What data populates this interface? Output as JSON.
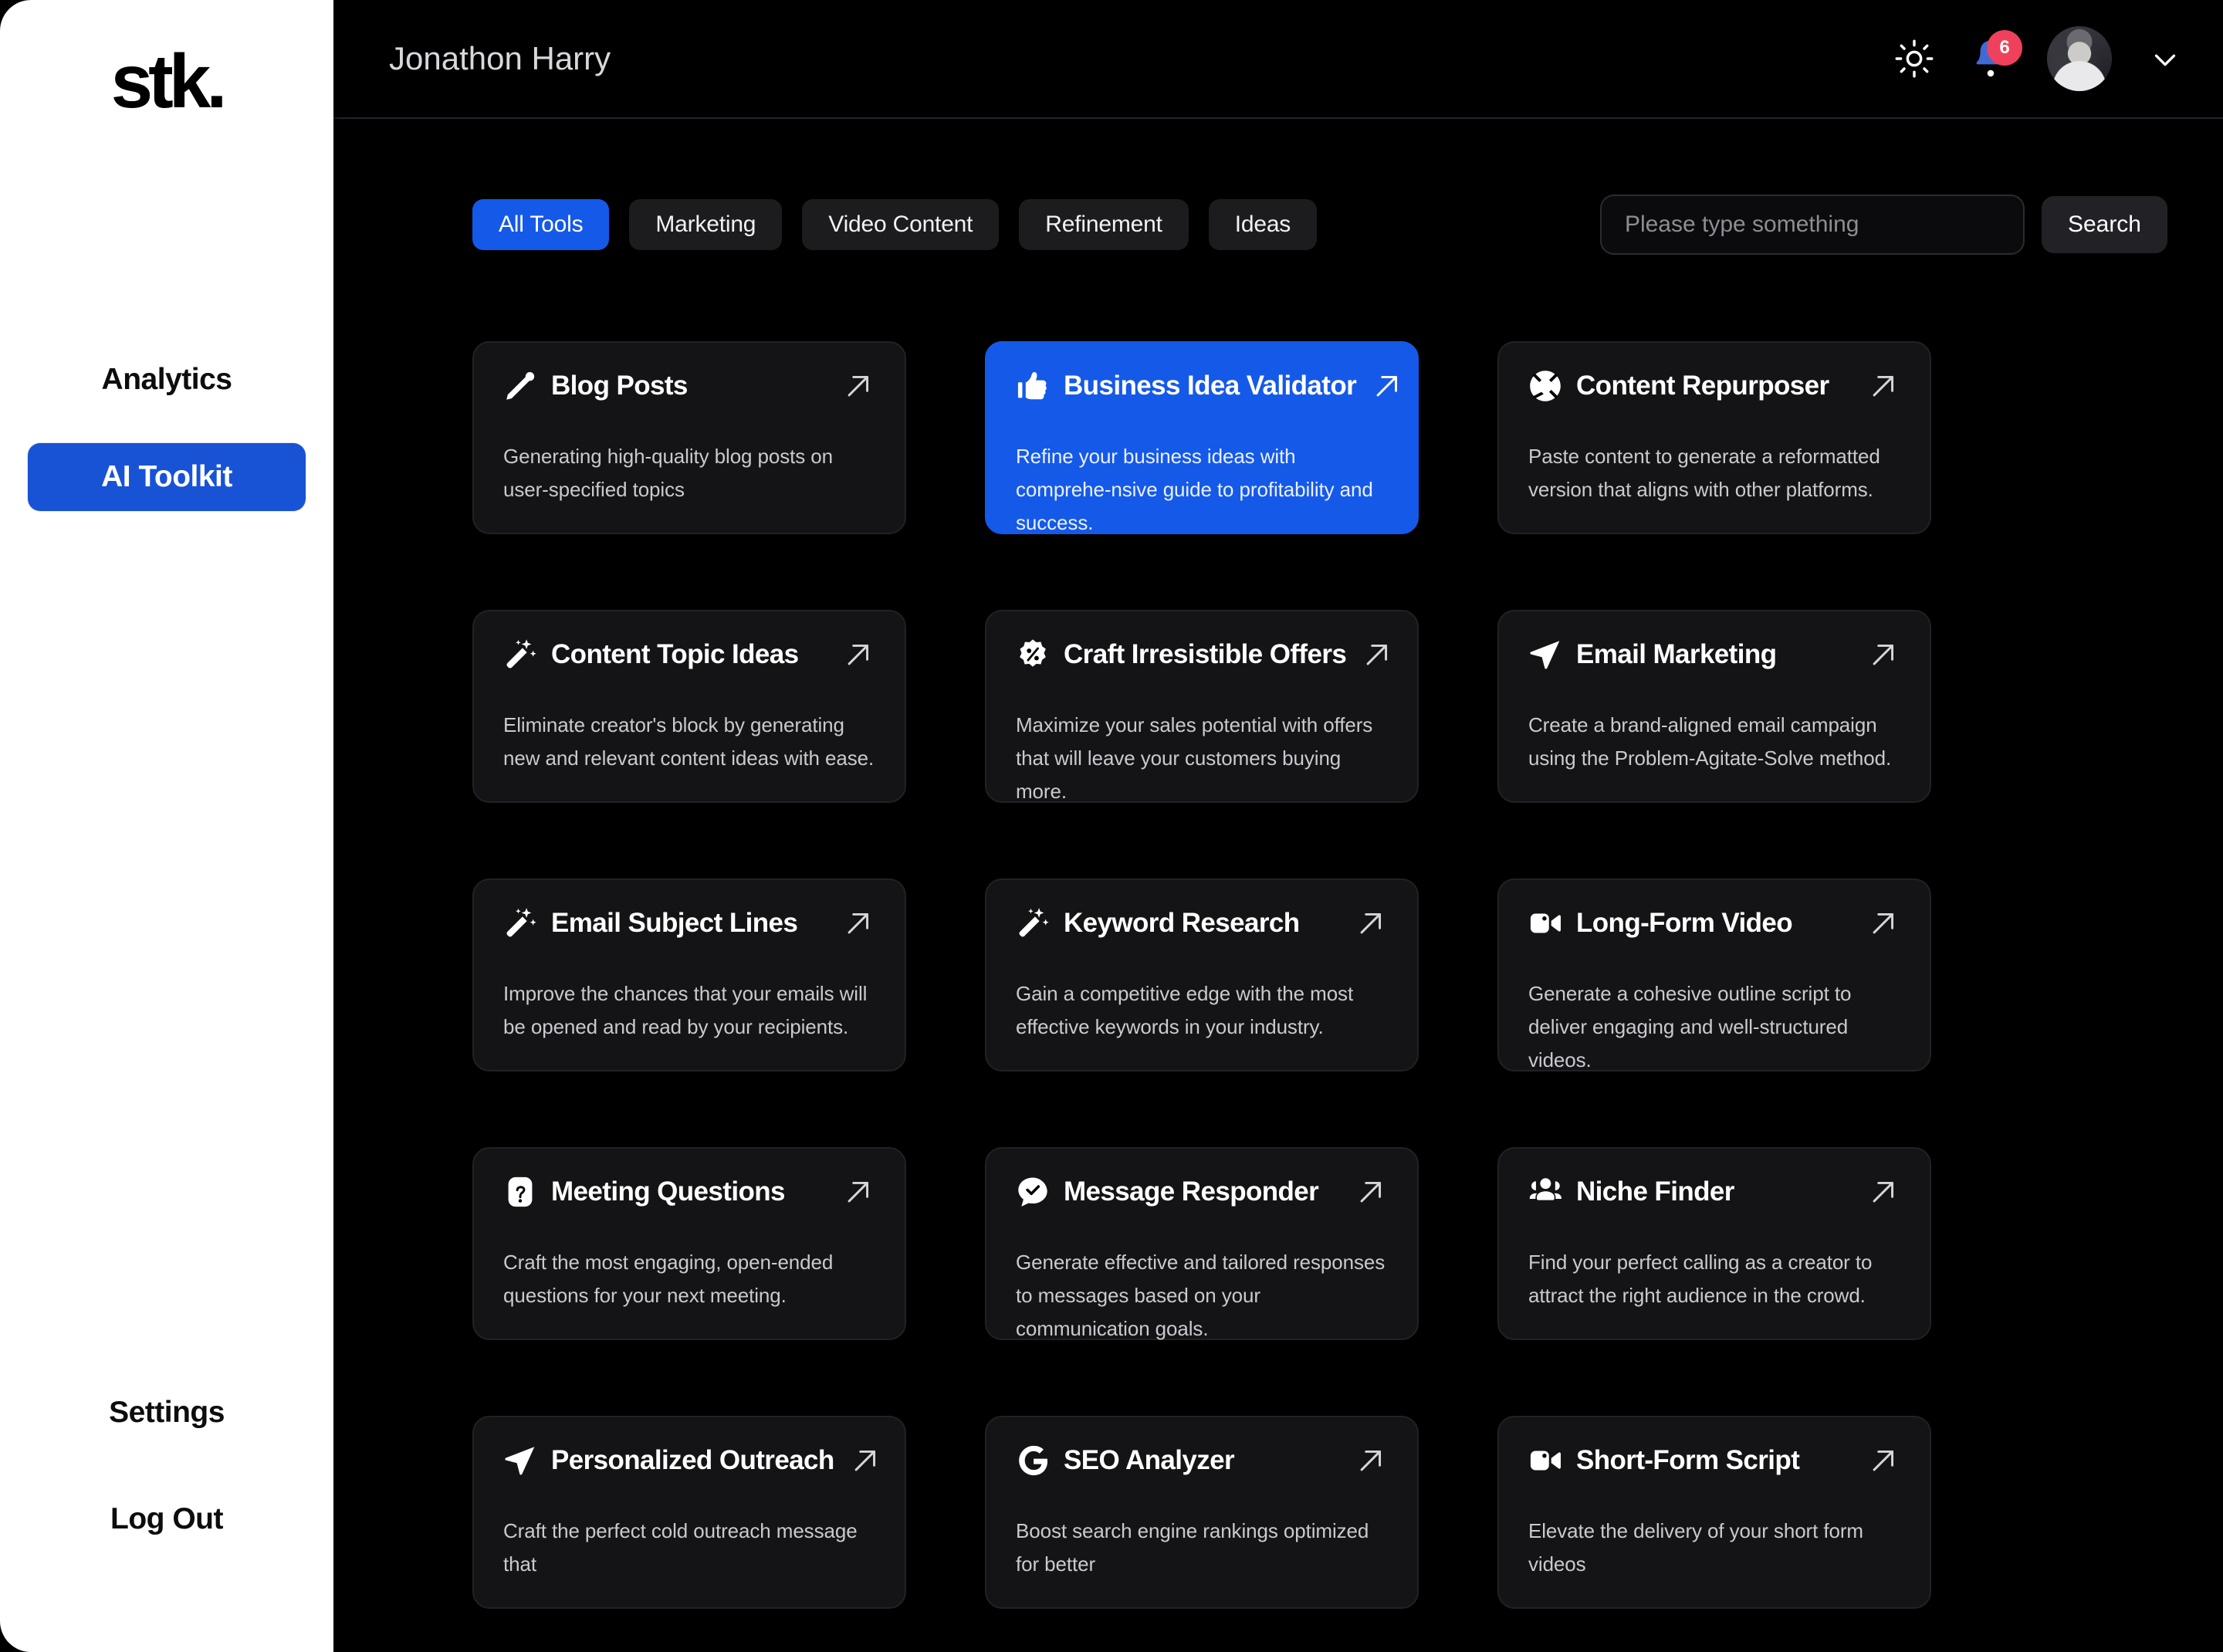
{
  "brand": {
    "logo_text": "stk."
  },
  "colors": {
    "accent": "#1559e8",
    "sidebar_active": "#1853d6",
    "badge": "#f0415c",
    "card_bg": "#141416",
    "page_bg": "#000000"
  },
  "sidebar": {
    "top_items": [
      {
        "label": "Analytics",
        "active": false
      },
      {
        "label": "AI Toolkit",
        "active": true
      }
    ],
    "bottom_items": [
      {
        "label": "Settings"
      },
      {
        "label": "Log Out"
      }
    ]
  },
  "topbar": {
    "title": "Jonathon Harry",
    "theme_icon": "sun-icon",
    "notifications_icon": "bell-icon",
    "notification_count": "6",
    "avatar_icon": "user-avatar",
    "dropdown_icon": "chevron-down-icon"
  },
  "filters": {
    "chips": [
      {
        "label": "All Tools",
        "active": true
      },
      {
        "label": "Marketing",
        "active": false
      },
      {
        "label": "Video Content",
        "active": false
      },
      {
        "label": "Refinement",
        "active": false
      },
      {
        "label": "Ideas",
        "active": false
      }
    ]
  },
  "search": {
    "placeholder": "Please type something",
    "value": "",
    "button_label": "Search"
  },
  "tools": [
    {
      "title": "Blog Posts",
      "description": "Generating high-quality blog posts on user-specified topics",
      "icon": "pencil-icon",
      "highlight": false
    },
    {
      "title": "Business Idea Validator",
      "description": "Refine your business ideas with comprehe-nsive guide to profitability and success.",
      "icon": "thumbs-up-icon",
      "highlight": true
    },
    {
      "title": "Content Repurposer",
      "description": "Paste content to generate a reformatted version that aligns with other platforms.",
      "icon": "lifebuoy-icon",
      "highlight": false
    },
    {
      "title": "Content Topic Ideas",
      "description": "Eliminate creator's block by generating new and relevant content ideas with ease.",
      "icon": "magic-wand-icon",
      "highlight": false
    },
    {
      "title": "Craft Irresistible Offers",
      "description": "Maximize your sales potential with offers that will leave your customers buying more.",
      "icon": "discount-badge-icon",
      "highlight": false
    },
    {
      "title": "Email Marketing",
      "description": "Create a brand-aligned email campaign using the Problem-Agitate-Solve method.",
      "icon": "paper-plane-icon",
      "highlight": false
    },
    {
      "title": "Email Subject Lines",
      "description": "Improve the chances that your emails will be opened and read by your recipients.",
      "icon": "magic-wand-icon",
      "highlight": false
    },
    {
      "title": "Keyword Research",
      "description": "Gain a competitive edge with the most effective keywords in your industry.",
      "icon": "magic-wand-icon",
      "highlight": false
    },
    {
      "title": "Long-Form Video",
      "description": "Generate a cohesive outline script to deliver engaging and well-structured videos.",
      "icon": "video-camera-icon",
      "highlight": false
    },
    {
      "title": "Meeting Questions",
      "description": "Craft the most engaging, open-ended questions for your next meeting.",
      "icon": "question-badge-icon",
      "highlight": false
    },
    {
      "title": "Message Responder",
      "description": "Generate effective and tailored responses to messages based on your communication goals.",
      "icon": "check-bubble-icon",
      "highlight": false
    },
    {
      "title": "Niche Finder",
      "description": "Find your perfect calling as a creator to attract the right audience in the crowd.",
      "icon": "users-icon",
      "highlight": false
    },
    {
      "title": "Personalized Outreach",
      "description": "Craft the perfect cold outreach message that",
      "icon": "paper-plane-icon",
      "highlight": false
    },
    {
      "title": "SEO Analyzer",
      "description": "Boost search engine rankings optimized for better",
      "icon": "google-g-icon",
      "highlight": false
    },
    {
      "title": "Short-Form Script",
      "description": "Elevate the delivery of your short form videos",
      "icon": "video-camera-icon",
      "highlight": false
    }
  ],
  "card_arrow_icon": "arrow-up-right-icon"
}
